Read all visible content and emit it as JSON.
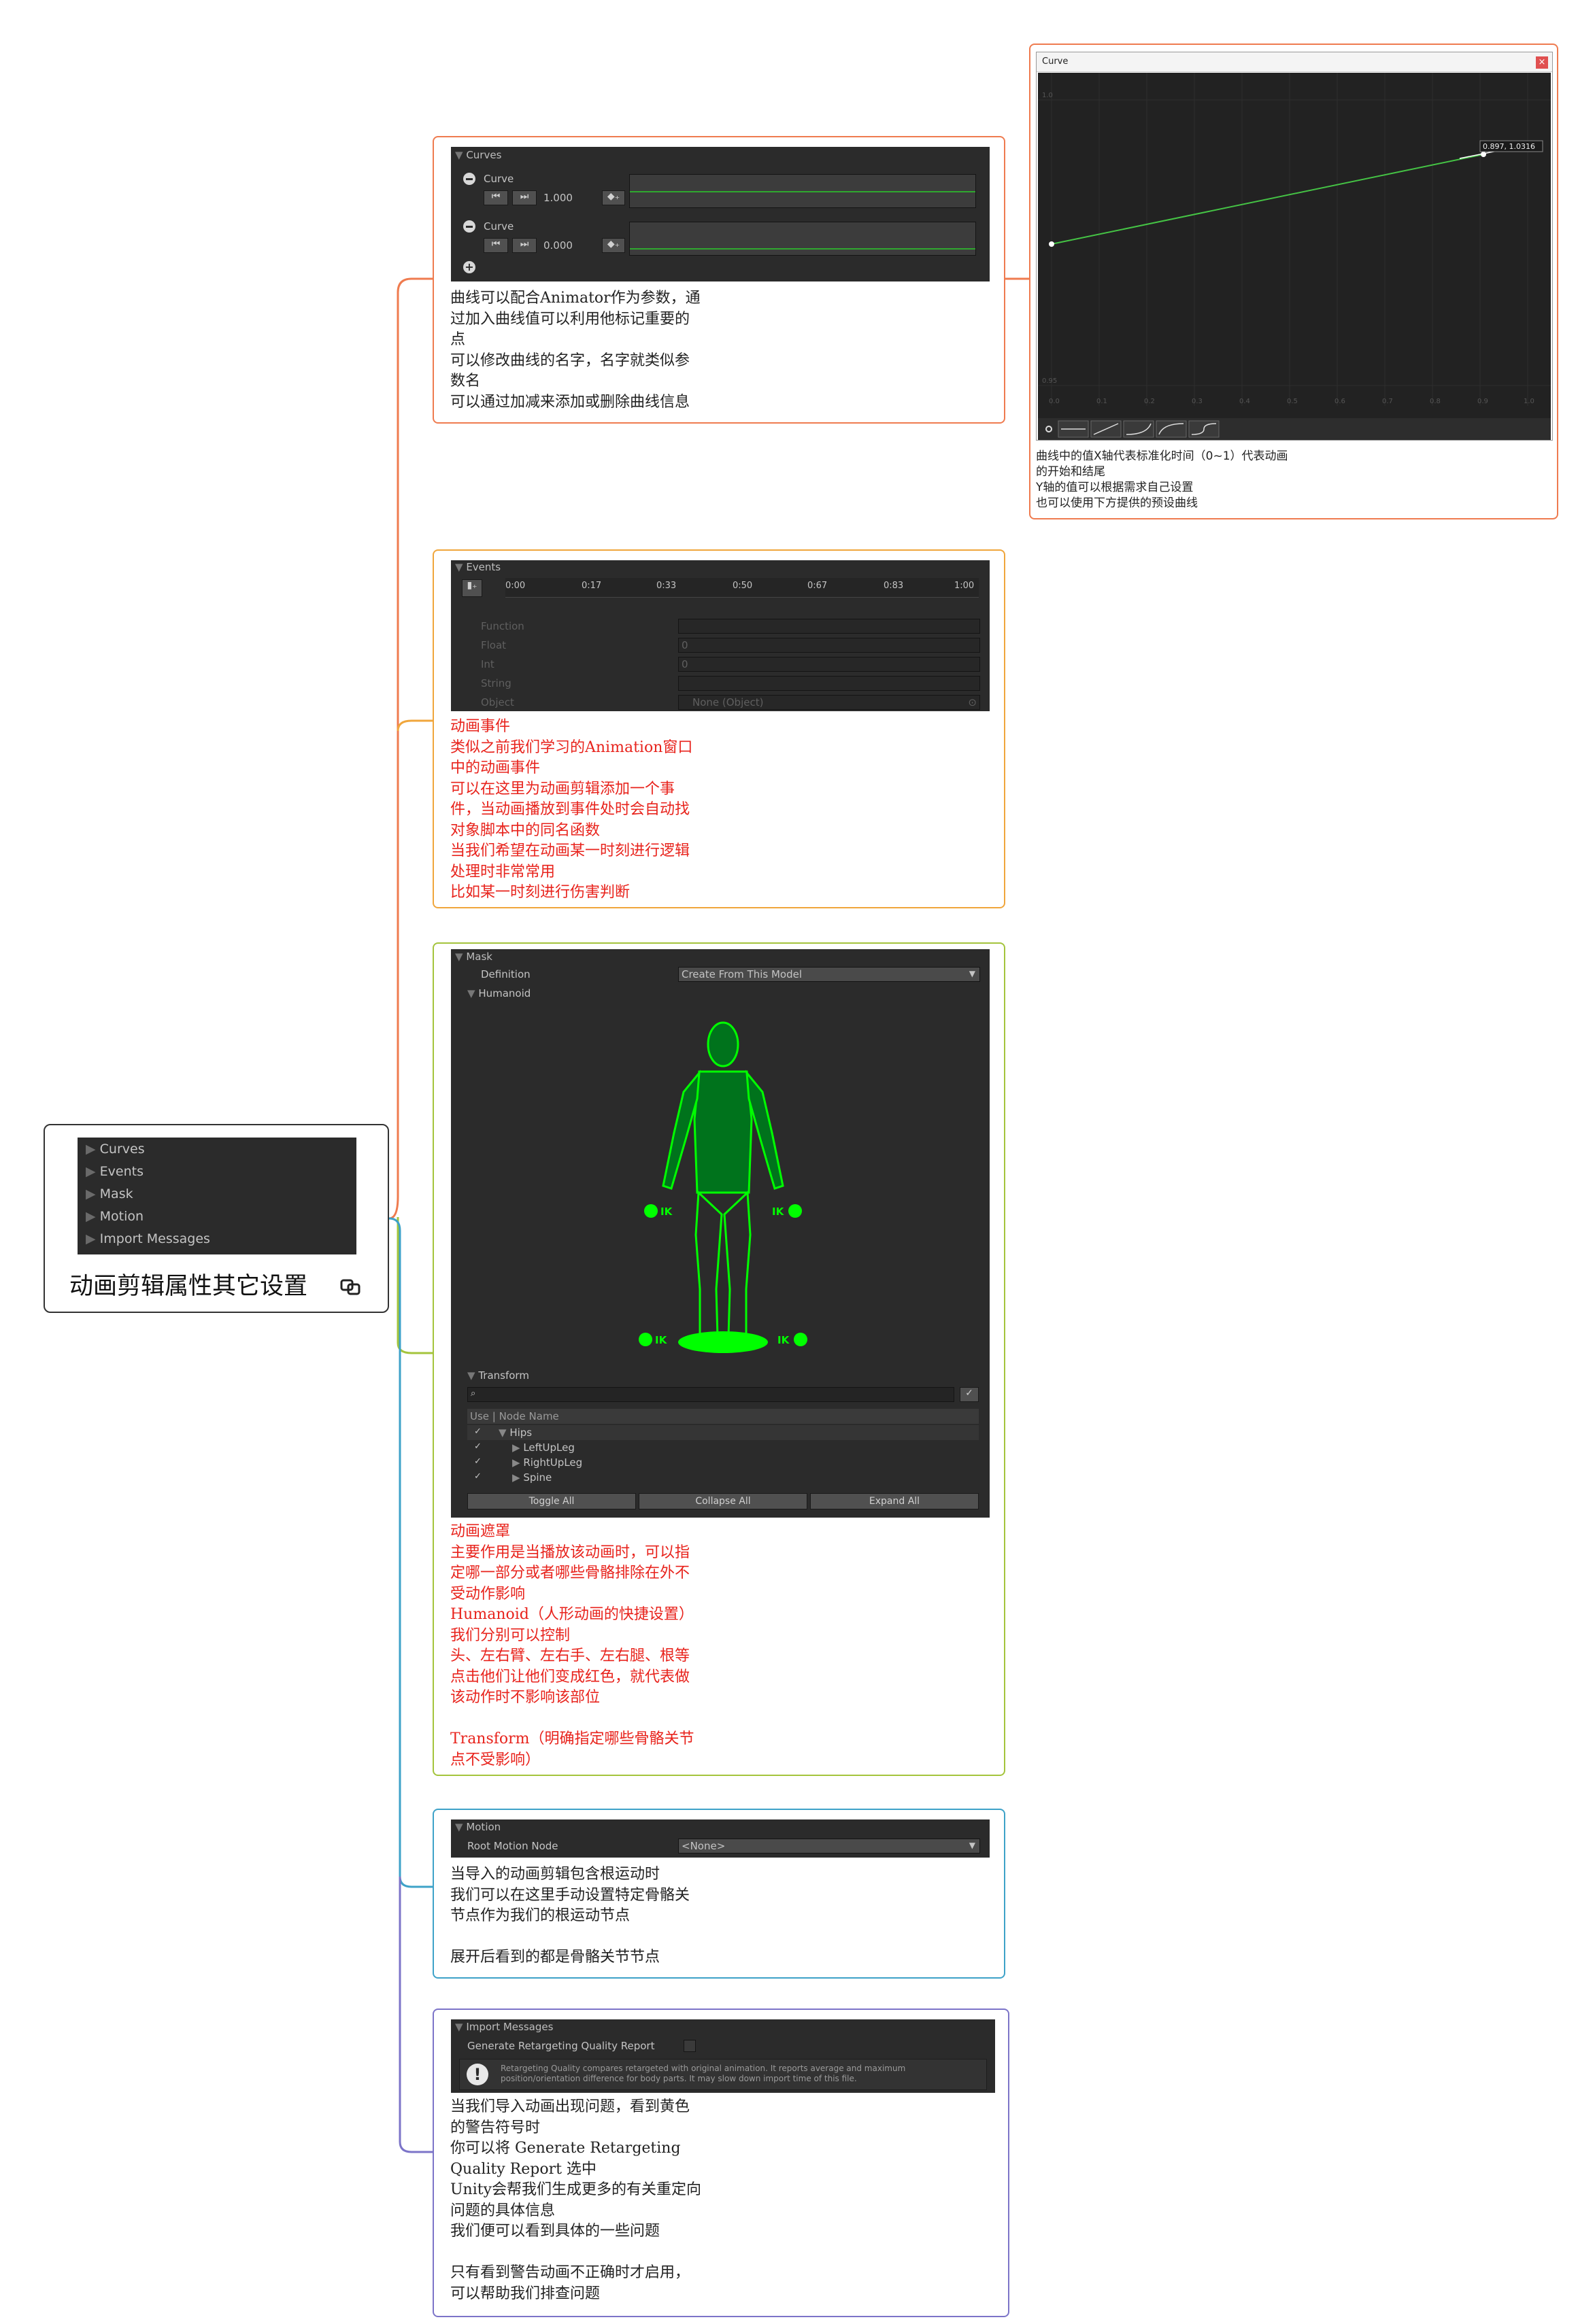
{
  "root": {
    "title": "动画剪辑属性其它设置",
    "link_icon": "link-icon",
    "panel_items": [
      "Curves",
      "Events",
      "Mask",
      "Motion",
      "Import Messages"
    ]
  },
  "curves_card": {
    "header": "Curves",
    "curve1": {
      "name": "Curve",
      "value": "1.000"
    },
    "curve2": {
      "name": "Curve",
      "value": "0.000"
    },
    "note": "曲线可以配合Animator作为参数，通\n过加入曲线值可以利用他标记重要的\n点\n可以修改曲线的名字，名字就类似参\n数名\n可以通过加减来添加或删除曲线信息",
    "color": "#ef7b4f"
  },
  "curve_window": {
    "title": "Curve",
    "point_label": "0.897, 1.0316",
    "y_labels": [
      "1.0",
      "0.95"
    ],
    "x_labels": [
      "0.0",
      "0.1",
      "0.2",
      "0.3",
      "0.4",
      "0.5",
      "0.6",
      "0.7",
      "0.8",
      "0.9",
      "1.0"
    ],
    "note": "曲线中的值X轴代表标准化时间（0~1）代表动画\n的开始和结尾\nY轴的值可以根据需求自己设置\n也可以使用下方提供的预设曲线",
    "color": "#ef7b4f"
  },
  "events_card": {
    "header": "Events",
    "timeline": [
      "0:00",
      "0:17",
      "0:33",
      "0:50",
      "0:67",
      "0:83",
      "1:00"
    ],
    "fields": [
      {
        "label": "Function",
        "value": ""
      },
      {
        "label": "Float",
        "value": "0"
      },
      {
        "label": "Int",
        "value": "0"
      },
      {
        "label": "String",
        "value": ""
      },
      {
        "label": "Object",
        "value": "None (Object)"
      }
    ],
    "note": "动画事件\n类似之前我们学习的Animation窗口\n中的动画事件\n可以在这里为动画剪辑添加一个事\n件，当动画播放到事件处时会自动找\n对象脚本中的同名函数\n当我们希望在动画某一时刻进行逻辑\n处理时非常常用\n比如某一时刻进行伤害判断",
    "color": "#f0a63c"
  },
  "mask_card": {
    "header": "Mask",
    "definition_label": "Definition",
    "definition_value": "Create From This Model",
    "humanoid_label": "Humanoid",
    "ik_label": "IK",
    "transform_label": "Transform",
    "columns": "Use | Node Name",
    "nodes": [
      "Hips",
      "LeftUpLeg",
      "RightUpLeg",
      "Spine"
    ],
    "buttons": [
      "Toggle All",
      "Collapse All",
      "Expand All"
    ],
    "figure_color": "#00ff00",
    "note": "动画遮罩\n主要作用是当播放该动画时，可以指\n定哪一部分或者哪些骨骼排除在外不\n受动作影响\nHumanoid（人形动画的快捷设置）\n我们分别可以控制\n头、左右臂、左右手、左右腿、根等\n点击他们让他们变成红色，就代表做\n该动作时不影响该部位\n\nTransform（明确指定哪些骨骼关节\n点不受影响）",
    "color": "#a4c43c"
  },
  "motion_card": {
    "header": "Motion",
    "root_label": "Root Motion Node",
    "root_value": "<None>",
    "note": "当导入的动画剪辑包含根运动时\n我们可以在这里手动设置特定骨骼关\n节点作为我们的根运动节点\n\n展开后看到的都是骨骼关节节点",
    "color": "#3ea2c8"
  },
  "import_card": {
    "header": "Import Messages",
    "option_label": "Generate Retargeting Quality Report",
    "info_text": "Retargeting Quality compares retargeted with original animation. It reports average and maximum position/orientation difference for body parts. It may slow down import time of this file.",
    "note": "当我们导入动画出现问题，看到黄色\n的警告符号时\n你可以将 Generate Retargeting\nQuality Report 选中\nUnity会帮我们生成更多的有关重定向\n问题的具体信息\n我们便可以看到具体的一些问题\n\n只有看到警告动画不正确时才启用，\n可以帮助我们排查问题",
    "color": "#7c74c8"
  }
}
